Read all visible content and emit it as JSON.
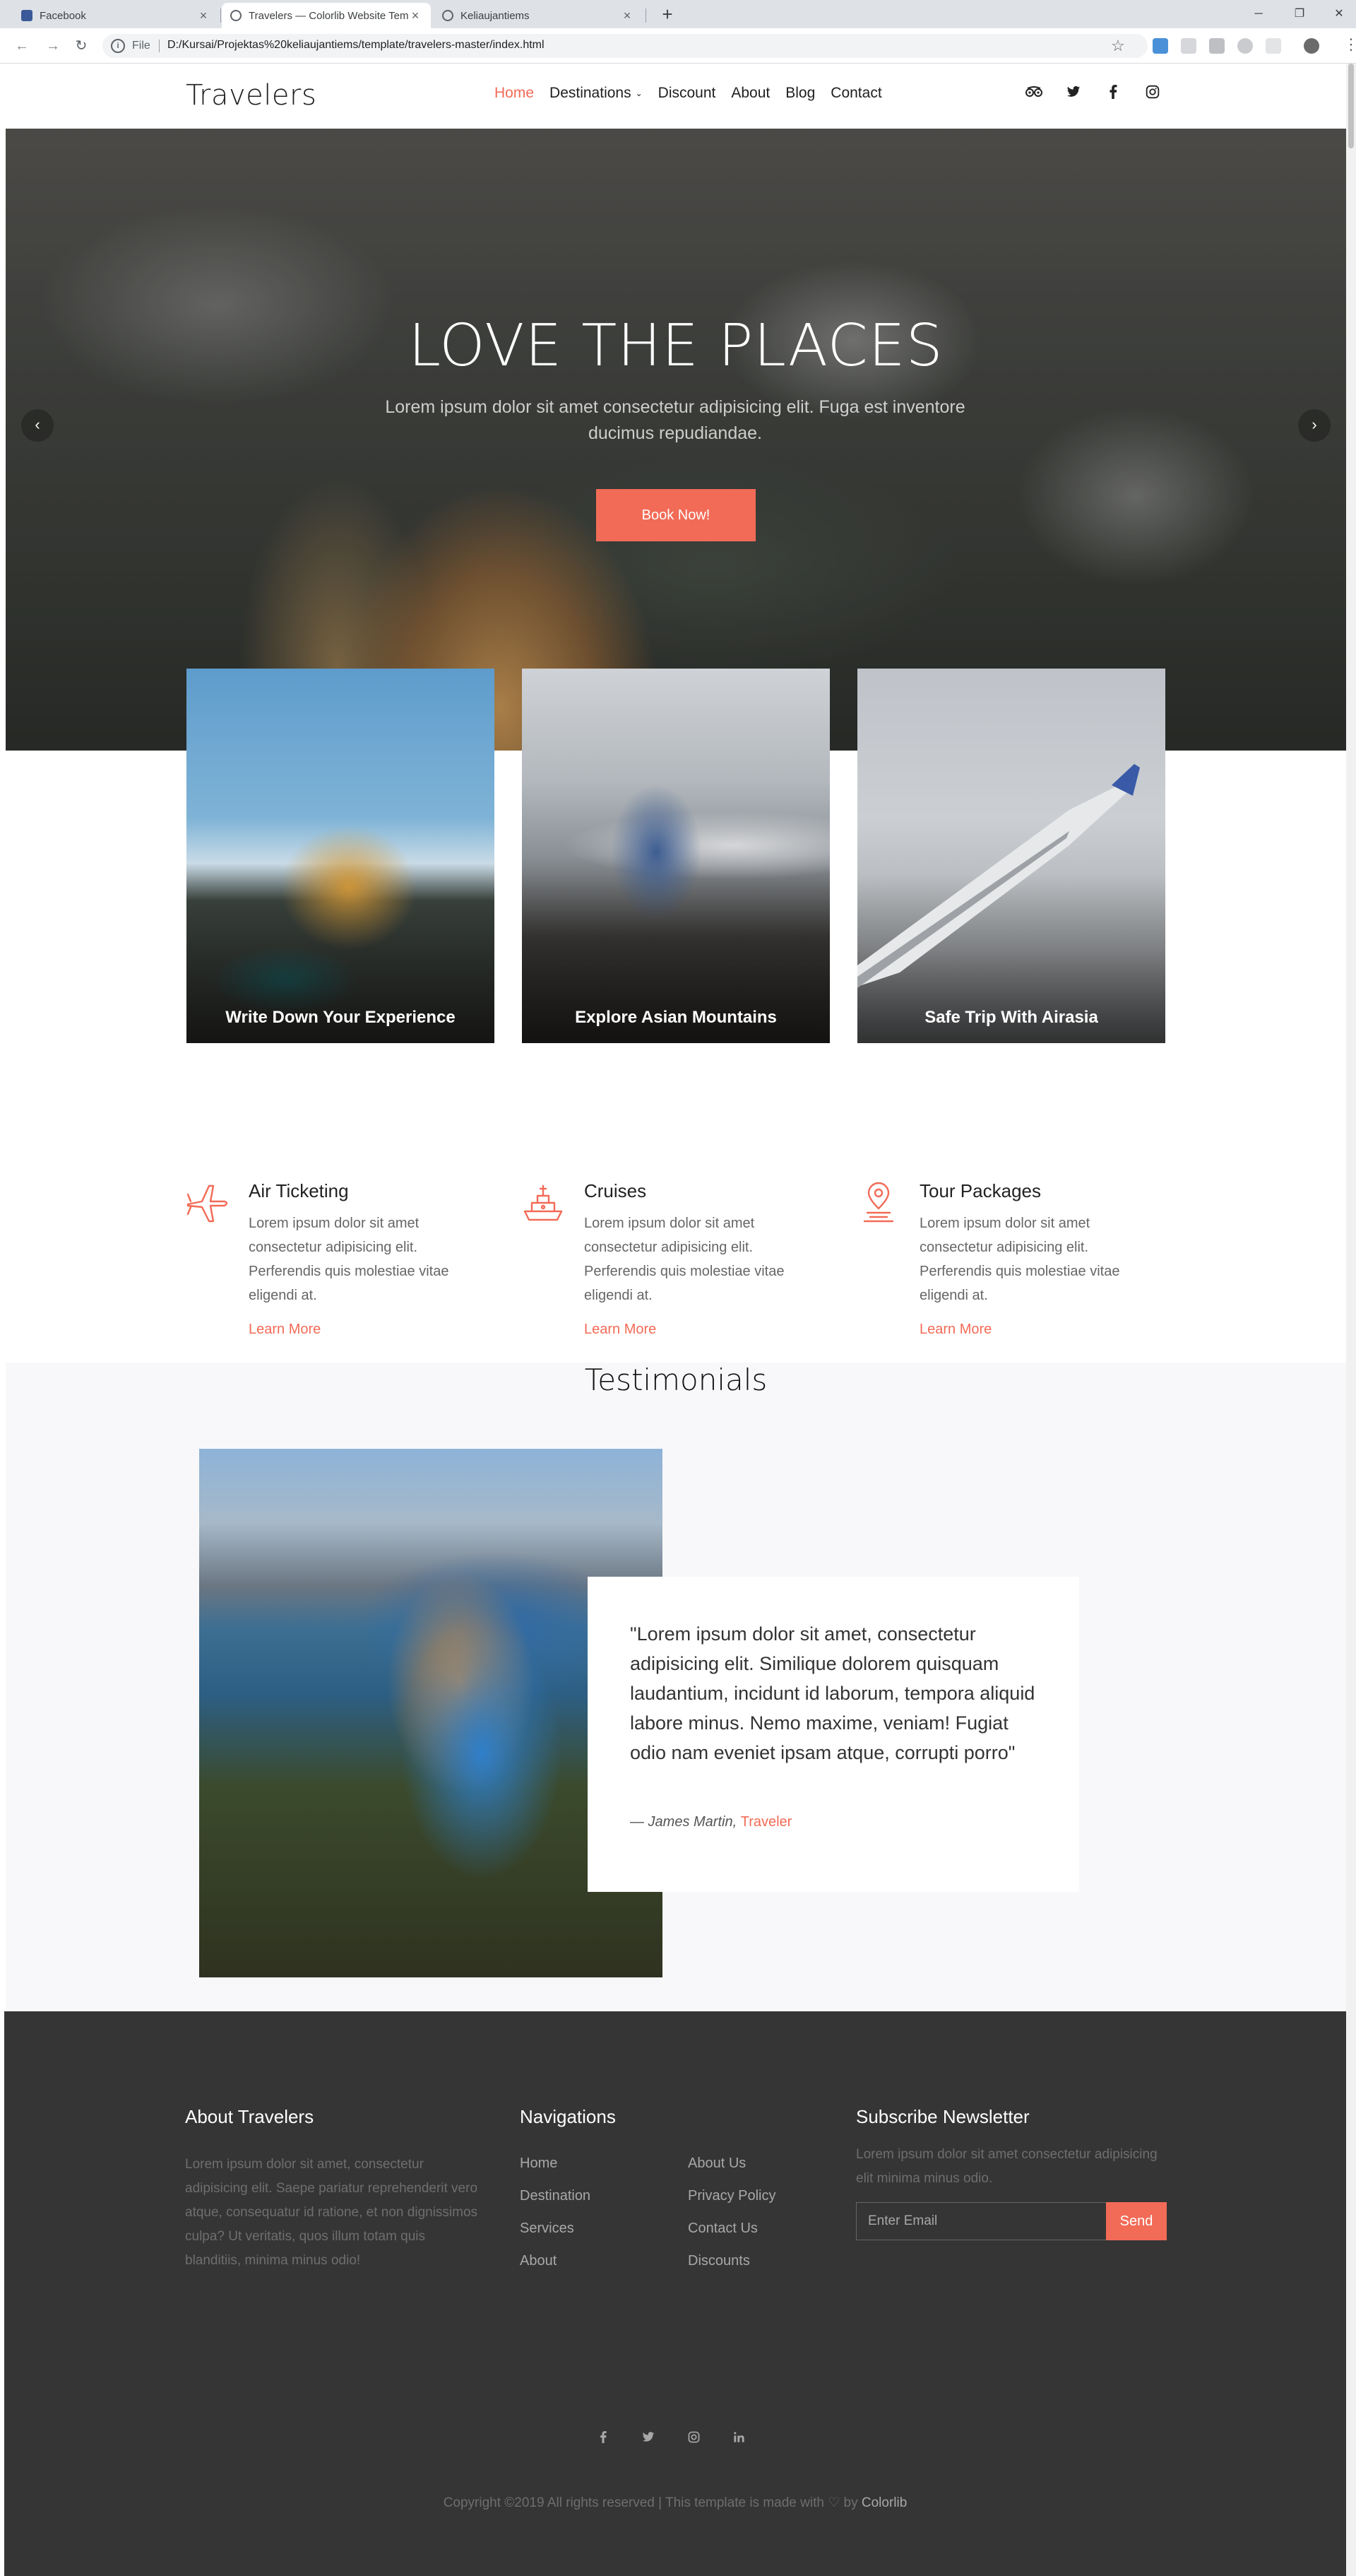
{
  "browser": {
    "tabs": [
      {
        "title": "Facebook",
        "color": "#3b5998"
      },
      {
        "title": "Travelers — Colorlib Website Temp",
        "color": "#5f6368"
      },
      {
        "title": "Keliaujantiems",
        "color": "#5f6368"
      }
    ],
    "address_prefix": "File",
    "url": "D:/Kursai/Projektas%20keliaujantiems/template/travelers-master/index.html"
  },
  "header": {
    "logo": "Travelers",
    "nav": [
      {
        "label": "Home",
        "active": true
      },
      {
        "label": "Destinations",
        "has_dropdown": true
      },
      {
        "label": "Discount"
      },
      {
        "label": "About"
      },
      {
        "label": "Blog"
      },
      {
        "label": "Contact"
      }
    ],
    "social_icons": [
      "tripadvisor-icon",
      "twitter-icon",
      "facebook-icon",
      "instagram-icon"
    ]
  },
  "hero": {
    "title": "LOVE THE PLACES",
    "subtitle": "Lorem ipsum dolor sit amet consectetur adipisicing elit. Fuga est inventore ducimus repudiandae.",
    "button": "Book Now!"
  },
  "cards": [
    {
      "title": "Write Down Your Experience"
    },
    {
      "title": "Explore Asian Mountains"
    },
    {
      "title": "Safe Trip With Airasia"
    }
  ],
  "services": [
    {
      "icon": "airplane-icon",
      "title": "Air Ticketing",
      "text": "Lorem ipsum dolor sit amet consectetur adipisicing elit. Perferendis quis molestiae vitae eligendi at.",
      "link": "Learn More"
    },
    {
      "icon": "ship-icon",
      "title": "Cruises",
      "text": "Lorem ipsum dolor sit amet consectetur adipisicing elit. Perferendis quis molestiae vitae eligendi at.",
      "link": "Learn More"
    },
    {
      "icon": "map-pin-icon",
      "title": "Tour Packages",
      "text": "Lorem ipsum dolor sit amet consectetur adipisicing elit. Perferendis quis molestiae vitae eligendi at.",
      "link": "Learn More"
    }
  ],
  "testimonials": {
    "heading": "Testimonials",
    "quote": "\"Lorem ipsum dolor sit amet, consectetur adipisicing elit. Similique dolorem quisquam laudantium, incidunt id laborum, tempora aliquid labore minus. Nemo maxime, veniam! Fugiat odio nam eveniet ipsam atque, corrupti porro\"",
    "author": "— James Martin,",
    "role": "Traveler"
  },
  "footer": {
    "about_title": "About Travelers",
    "about_text": "Lorem ipsum dolor sit amet, consectetur adipisicing elit. Saepe pariatur reprehenderit vero atque, consequatur id ratione, et non dignissimos culpa? Ut veritatis, quos illum totam quis blanditiis, minima minus odio!",
    "nav_title": "Navigations",
    "nav_col1": [
      "Home",
      "Destination",
      "Services",
      "About"
    ],
    "nav_col2": [
      "About Us",
      "Privacy Policy",
      "Contact Us",
      "Discounts"
    ],
    "newsletter_title": "Subscribe Newsletter",
    "newsletter_text": "Lorem ipsum dolor sit amet consectetur adipisicing elit minima minus odio.",
    "email_placeholder": "Enter Email",
    "send_label": "Send",
    "social_icons": [
      "facebook-icon",
      "twitter-icon",
      "instagram-icon",
      "linkedin-icon"
    ],
    "copyright_prefix": "Copyright ©2019 All rights reserved | This template is made with ♡ by",
    "copyright_brand": "Colorlib"
  },
  "colors": {
    "accent": "#f26b57",
    "footer_bg": "#353535",
    "testimonial_bg": "#f8f8fa"
  }
}
